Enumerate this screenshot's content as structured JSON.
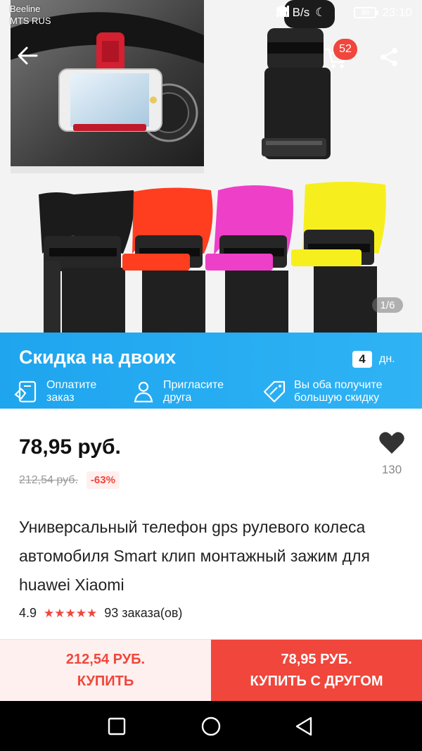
{
  "status_bar": {
    "carrier_1": "Beeline",
    "carrier_2": "MTS RUS",
    "net_speed": "51 B/s",
    "battery": "90",
    "time": "23:10"
  },
  "header": {
    "cart_count": "52",
    "icons": [
      "back-arrow-icon",
      "cart-icon",
      "share-icon"
    ]
  },
  "gallery": {
    "page_indicator": "1/6",
    "strap_colors": [
      "#1b1b1b",
      "#ff3d1f",
      "#ee3fc9",
      "#f7ef1d"
    ]
  },
  "promo": {
    "title": "Скидка на двоих",
    "days_value": "4",
    "days_unit": "дн.",
    "steps": [
      {
        "line1": "Оплатите",
        "line2": "заказ",
        "icon": "pay-order-icon"
      },
      {
        "line1": "Пригласите",
        "line2": "друга",
        "icon": "invite-friend-icon"
      },
      {
        "line1": "Вы оба получите",
        "line2": "большую скидку",
        "icon": "discount-tag-icon"
      }
    ],
    "color": "#1ea5ee"
  },
  "product": {
    "price": "78,95 руб.",
    "old_price": "212,54 руб.",
    "discount": "-63%",
    "wishlist_count": "130",
    "title": "Универсальный телефон gps рулевого колеса автомобиля Smart клип монтажный зажим для huawei Xiaomi",
    "rating": "4.9",
    "stars": "★★★★★",
    "orders": "93 заказа(ов)"
  },
  "actions": {
    "solo_price": "212,54 РУБ.",
    "solo_label": "КУПИТЬ",
    "duo_price": "78,95 РУБ.",
    "duo_label": "КУПИТЬ С ДРУГОМ",
    "accent": "#f0463c"
  }
}
